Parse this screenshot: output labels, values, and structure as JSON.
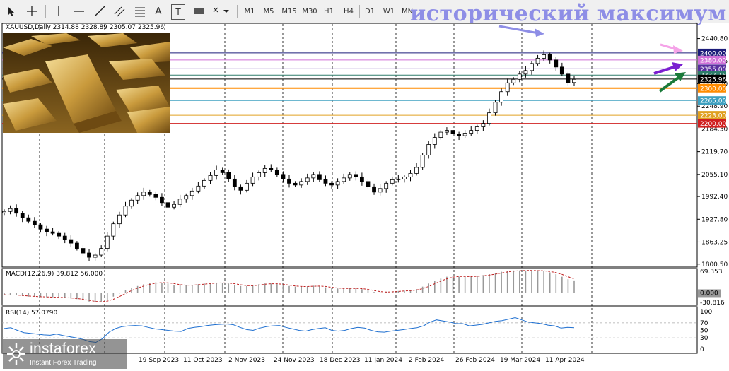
{
  "toolbar": {
    "timeframes": [
      "M1",
      "M5",
      "M15",
      "M30",
      "H1",
      "H4",
      "D1",
      "W1",
      "MN"
    ],
    "tools": {
      "text_tool": "A",
      "label_tool": "T"
    }
  },
  "headline": "исторический максимум",
  "symbol_label": "XAUUSD,Daily  2314.88 2328.89 2305.07 2325.96",
  "watermark": {
    "brand": "instaforex",
    "tagline": "Instant Forex Trading"
  },
  "colors": {
    "bull": "#000000",
    "bear": "#000000",
    "grid": "#000000",
    "headline": "#8e8ee6",
    "accent_orange": "#ff8c00"
  },
  "chart_data": {
    "type": "candlestick",
    "symbol": "XAUUSD",
    "timeframe": "Daily",
    "ohlc_last": {
      "open": 2314.88,
      "high": 2328.89,
      "low": 2305.07,
      "close": 2325.96
    },
    "ylim": [
      1800,
      2460
    ],
    "price_ticks": [
      2440.8,
      2376.65,
      2312.5,
      2248.9,
      2184.3,
      2119.7,
      2055.1,
      1992.4,
      1927.8,
      1863.25,
      1800.5
    ],
    "x_labels": [
      "19 Sep 2023",
      "11 Oct 2023",
      "2 Nov 2023",
      "24 Nov 2023",
      "18 Dec 2023",
      "11 Jan 2024",
      "2 Feb 2024",
      "26 Feb 2024",
      "19 Mar 2024",
      "11 Apr 2024"
    ],
    "closes": [
      1950,
      1958,
      1945,
      1932,
      1922,
      1912,
      1900,
      1892,
      1888,
      1880,
      1870,
      1860,
      1845,
      1832,
      1820,
      1826,
      1845,
      1880,
      1915,
      1940,
      1965,
      1982,
      1995,
      2005,
      1998,
      1990,
      1975,
      1962,
      1970,
      1985,
      1995,
      2008,
      2022,
      2038,
      2052,
      2068,
      2060,
      2042,
      2020,
      2010,
      2030,
      2048,
      2060,
      2072,
      2068,
      2055,
      2042,
      2030,
      2025,
      2035,
      2045,
      2055,
      2040,
      2030,
      2025,
      2035,
      2045,
      2055,
      2048,
      2035,
      2020,
      2005,
      2015,
      2030,
      2040,
      2042,
      2048,
      2058,
      2075,
      2110,
      2140,
      2160,
      2175,
      2180,
      2170,
      2165,
      2172,
      2180,
      2190,
      2200,
      2230,
      2260,
      2290,
      2315,
      2325,
      2340,
      2350,
      2370,
      2385,
      2395,
      2380,
      2360,
      2340,
      2316,
      2325
    ],
    "horizontal_levels": [
      {
        "value": 2400.0,
        "label": "2400.00",
        "color": "#1c1c7a"
      },
      {
        "value": 2380.0,
        "label": "2380.00",
        "color": "#d070d8"
      },
      {
        "value": 2355.0,
        "label": "2355.00",
        "color": "#5a2fa0"
      },
      {
        "value": 2337.16,
        "label": "2337.16",
        "color": "#2e7d6a"
      },
      {
        "value": 2325.96,
        "label": "2325.96",
        "color": "#000000"
      },
      {
        "value": 2300.0,
        "label": "2300.00",
        "color": "#ff8c00"
      },
      {
        "value": 2265.0,
        "label": "2265.00",
        "color": "#3ea0c0"
      },
      {
        "value": 2223.0,
        "label": "2223.00",
        "color": "#e0a020"
      },
      {
        "value": 2200.0,
        "label": "2200.00",
        "color": "#d02020"
      }
    ],
    "macd": {
      "label": "MACD(12,26,9) 39.812 56.000",
      "params": [
        12,
        26,
        9
      ],
      "main": 39.812,
      "signal": 56.0,
      "ylim": [
        -30.816,
        69.353
      ],
      "ticks": [
        69.353,
        0.0,
        -30.816
      ],
      "hist": [
        -6,
        -7,
        -8,
        -10,
        -12,
        -12,
        -13,
        -14,
        -14,
        -15,
        -16,
        -18,
        -20,
        -24,
        -28,
        -30,
        -28,
        -22,
        -12,
        -2,
        8,
        16,
        22,
        28,
        32,
        34,
        33,
        30,
        26,
        24,
        24,
        26,
        28,
        30,
        32,
        33,
        32,
        30,
        26,
        22,
        22,
        25,
        28,
        30,
        30,
        28,
        25,
        22,
        20,
        20,
        21,
        23,
        21,
        18,
        15,
        14,
        14,
        15,
        14,
        12,
        8,
        3,
        2,
        3,
        5,
        6,
        7,
        9,
        12,
        20,
        30,
        38,
        46,
        52,
        54,
        52,
        52,
        53,
        55,
        57,
        60,
        64,
        68,
        70,
        72,
        72,
        72,
        72,
        71,
        70,
        66,
        60,
        52,
        44,
        40
      ]
    },
    "rsi": {
      "label": "RSI(14) 57.0790",
      "period": 14,
      "value": 57.079,
      "ylim": [
        0,
        100
      ],
      "ticks": [
        100,
        70,
        50,
        30,
        0
      ],
      "values": [
        55,
        57,
        50,
        44,
        42,
        40,
        38,
        37,
        40,
        36,
        33,
        30,
        26,
        20,
        18,
        28,
        45,
        55,
        60,
        62,
        63,
        62,
        58,
        54,
        52,
        50,
        48,
        47,
        55,
        58,
        60,
        63,
        65,
        66,
        67,
        65,
        58,
        52,
        50,
        56,
        60,
        62,
        63,
        58,
        54,
        50,
        48,
        52,
        55,
        57,
        50,
        48,
        50,
        55,
        58,
        56,
        50,
        46,
        45,
        48,
        50,
        52,
        55,
        57,
        62,
        72,
        78,
        75,
        72,
        68,
        68,
        62,
        64,
        66,
        70,
        74,
        76,
        80,
        84,
        78,
        72,
        70,
        68,
        64,
        62,
        56,
        58,
        57
      ]
    }
  }
}
